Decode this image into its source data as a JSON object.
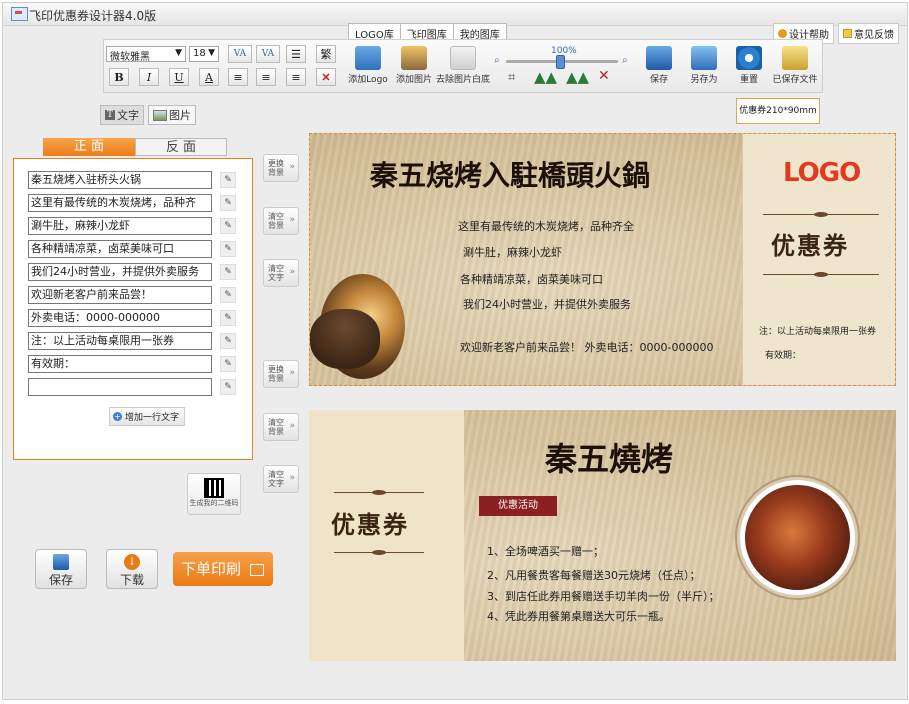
{
  "app": {
    "title": "飞印优惠券设计器4.0版"
  },
  "library_tabs": [
    "LOGO库",
    "飞印图库",
    "我的图库"
  ],
  "help": {
    "design_help": "设计帮助",
    "feedback": "意见反馈"
  },
  "toolbar": {
    "font_family": "微软雅黑",
    "font_size": "18",
    "bold": "B",
    "italic": "I",
    "underline": "U",
    "color": "A",
    "traditional": "繁",
    "zoom": "100%",
    "tools": {
      "add_logo": "添加Logo",
      "add_image": "添加图片",
      "remove_white": "去除图片白底",
      "save": "保存",
      "save_as": "另存为",
      "reset": "重置",
      "saved_files": "已保存文件"
    }
  },
  "mode_tabs": {
    "text": "文字",
    "image": "图片"
  },
  "size_badge": "优惠券210*90mm",
  "side_tabs": {
    "front": "正 面",
    "back": "反 面"
  },
  "text_lines": [
    "秦五烧烤入驻桥头火锅",
    "这里有最传统的木炭烧烤，品种齐",
    "涮牛肚，麻辣小龙虾",
    "各种精靖凉菜，卤菜美味可口",
    "我们24小时营业，并提供外卖服务",
    "欢迎新老客户前来品尝！",
    "外卖电话：0000-000000",
    "注：以上活动每桌限用一张券",
    "有效期：",
    ""
  ],
  "add_line": "增加一行文字",
  "side_buttons": {
    "change_bg": "更换背景",
    "clear_bg": "清空背景",
    "clear_text": "清空文字"
  },
  "qr": {
    "label": "生成我的二维码"
  },
  "actions": {
    "save": "保存",
    "download": "下载",
    "print": "下单印刷"
  },
  "front_coupon": {
    "headline": "秦五烧烤入駐橋頭火鍋",
    "lines": [
      "这里有最传统的木炭烧烤，品种齐全",
      "涮牛肚，麻辣小龙虾",
      "各种精靖凉菜，卤菜美味可口",
      "我们24小时营业，并提供外卖服务",
      "欢迎新老客户前来品尝！ 外卖电话：0000-000000"
    ],
    "logo": "LOGO",
    "coupon_label": "优惠券",
    "note": "注：以上活动每桌限用一张券",
    "validity": "有效期："
  },
  "back_coupon": {
    "coupon_label": "优惠券",
    "headline": "秦五燒烤",
    "promo": "优惠活动",
    "items": [
      "1、全场啤酒买一赠一；",
      "2、凡用餐贵客每餐赠送30元烧烤（任点）；",
      "3、到店任此券用餐赠送手切羊肉一份（半斤）；",
      "4、凭此券用餐第桌赠送大可乐一瓶。"
    ]
  }
}
